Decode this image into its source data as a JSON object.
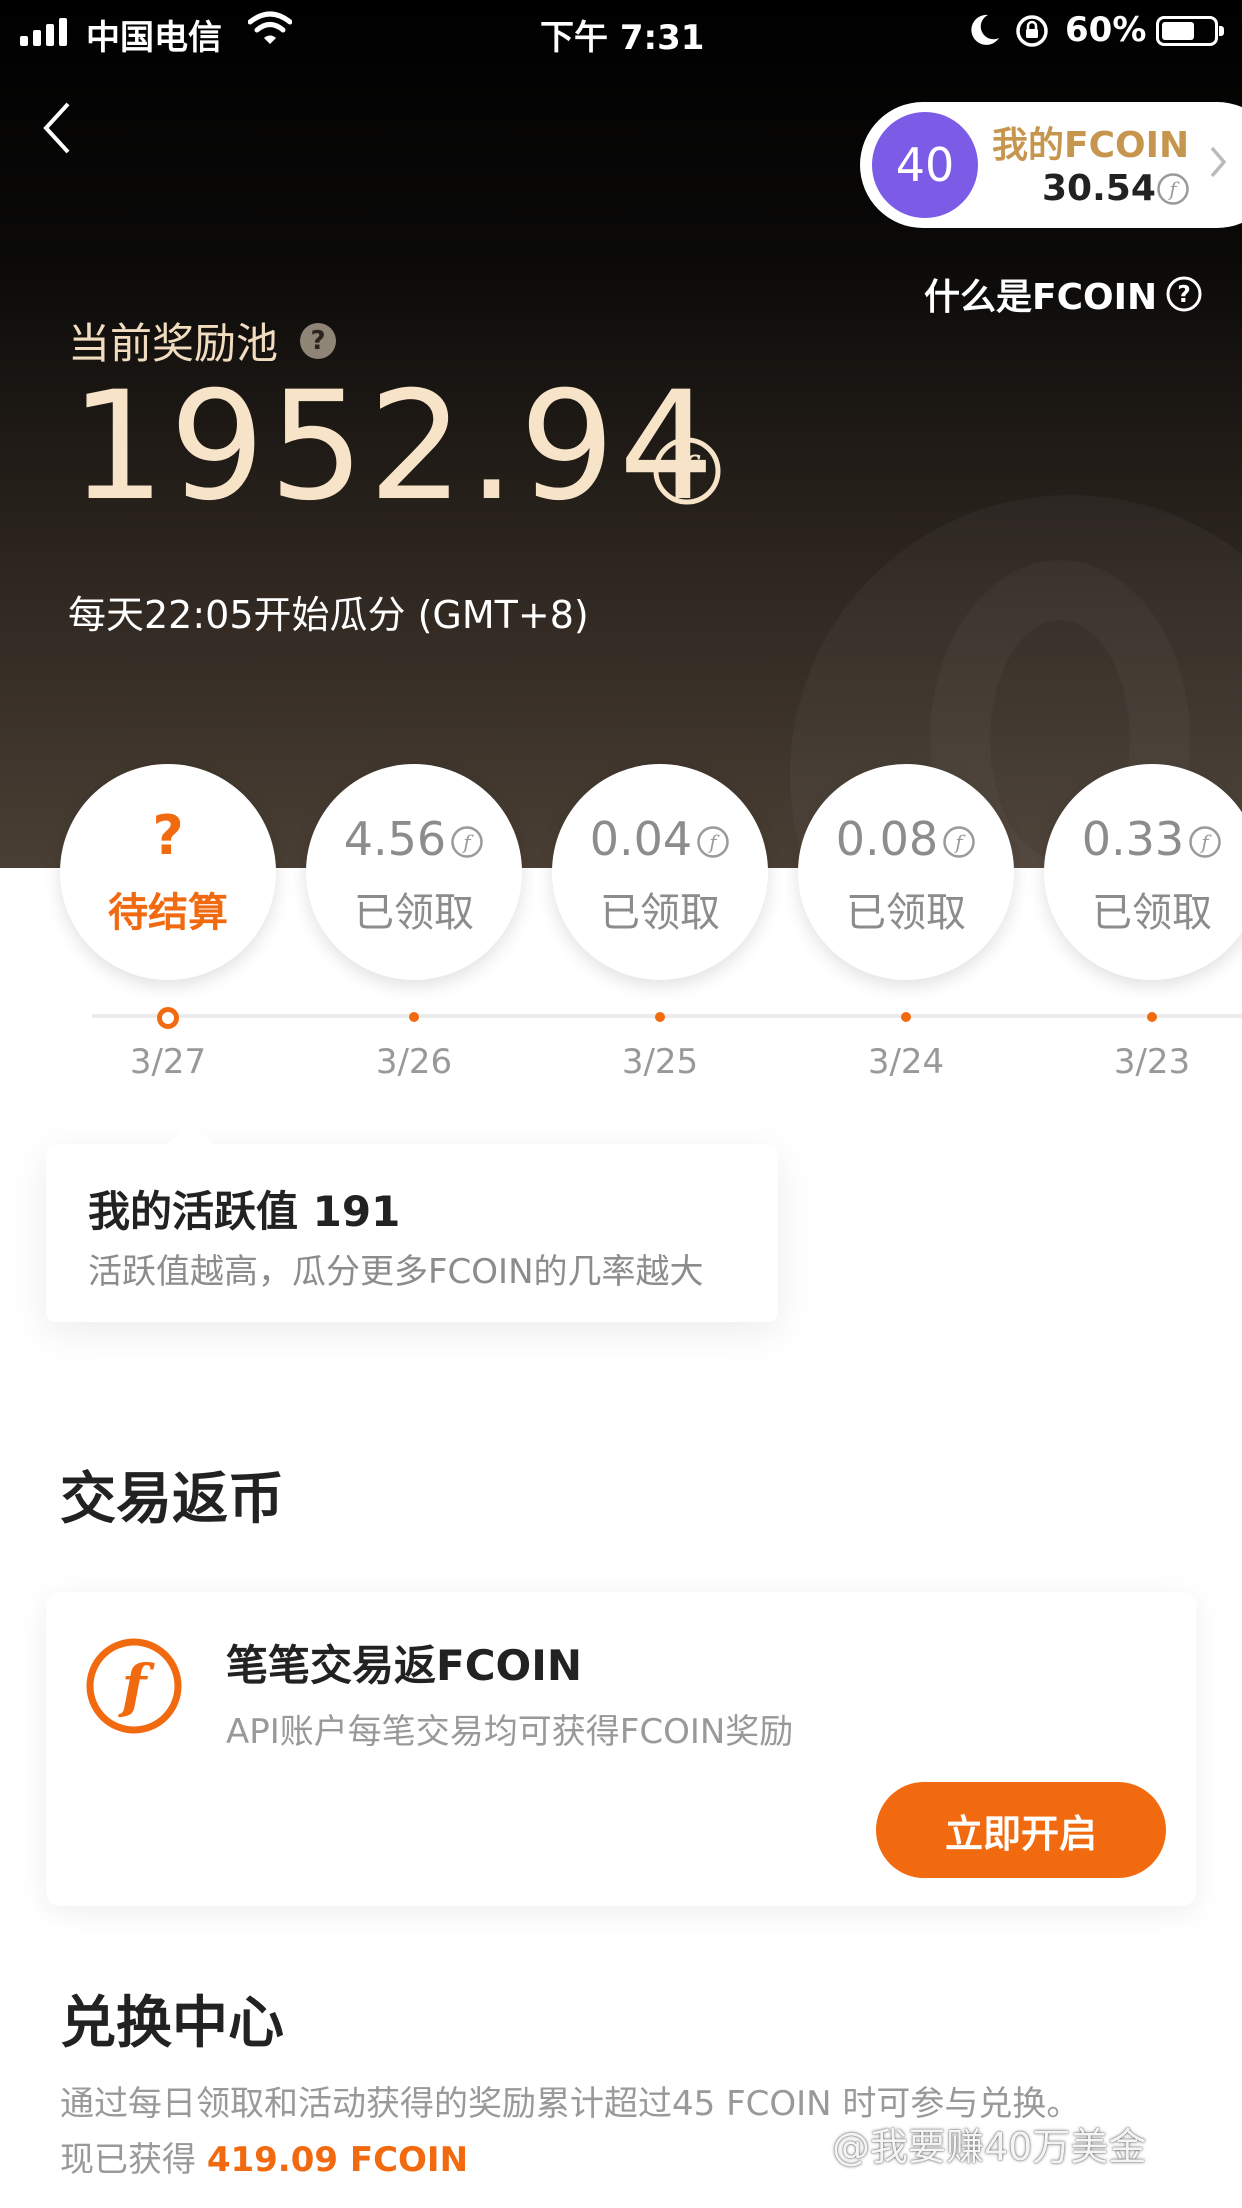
{
  "status_bar": {
    "carrier": "中国电信",
    "time": "下午 7:31",
    "battery": "60%"
  },
  "header": {
    "my_fcoin": {
      "level": "40",
      "label": "我的FCOIN",
      "amount": "30.54"
    },
    "what_is_fcoin": "什么是FCOIN"
  },
  "pool": {
    "label": "当前奖励池",
    "amount": "1952.94",
    "schedule": "每天22:05开始瓜分 (GMT+8)"
  },
  "days": [
    {
      "date": "3/27",
      "value": "?",
      "status": "待结算",
      "current": true
    },
    {
      "date": "3/26",
      "value": "4.56",
      "status": "已领取"
    },
    {
      "date": "3/25",
      "value": "0.04",
      "status": "已领取"
    },
    {
      "date": "3/24",
      "value": "0.08",
      "status": "已领取"
    },
    {
      "date": "3/23",
      "value": "0.33",
      "status": "已领取"
    }
  ],
  "activity_tip": {
    "title": "我的活跃值 191",
    "subtitle": "活跃值越高，瓜分更多FCOIN的几率越大"
  },
  "trade_rebate": {
    "section_title": "交易返币",
    "card_title": "笔笔交易返FCOIN",
    "card_subtitle": "API账户每笔交易均可获得FCOIN奖励",
    "button": "立即开启"
  },
  "exchange": {
    "section_title": "兑换中心",
    "description": "通过每日领取和活动获得的奖励累计超过45 FCOIN 时可参与兑换。",
    "obtained_prefix": "现已获得",
    "obtained_value": "419.09 FCOIN"
  },
  "watermark": "@我要赚40万美金",
  "colors": {
    "accent": "#f26a10",
    "gold": "#c6964e",
    "level_badge": "#7c5ce6"
  }
}
